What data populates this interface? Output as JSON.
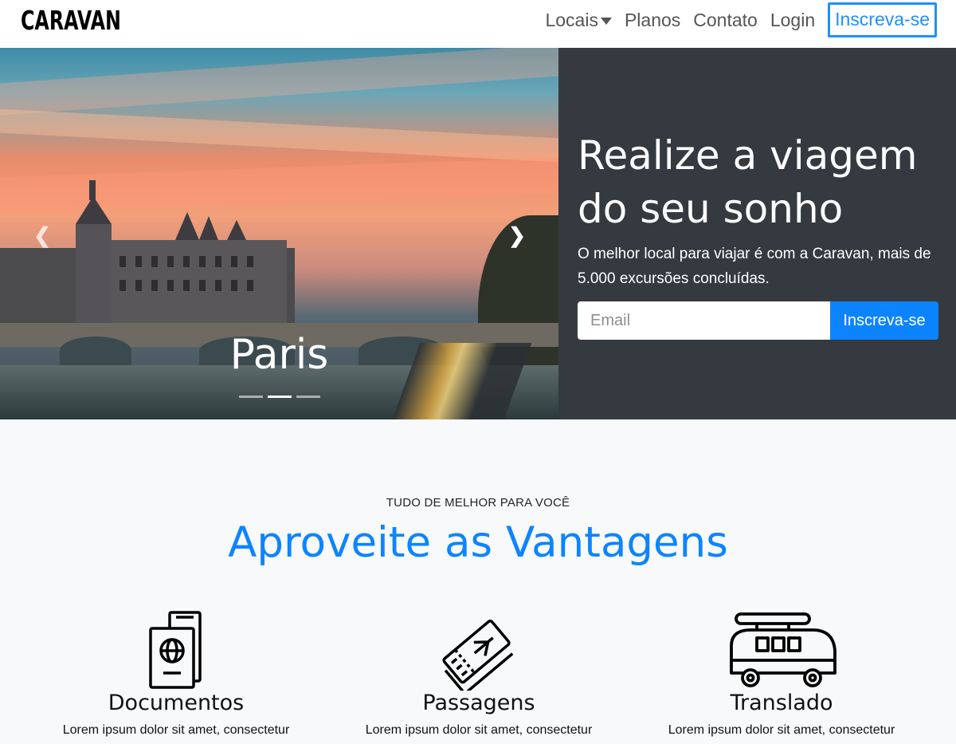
{
  "navbar": {
    "brand": "CARAVAN",
    "links": [
      {
        "label": "Locais"
      },
      {
        "label": "Planos"
      },
      {
        "label": "Contato"
      },
      {
        "label": "Login"
      }
    ],
    "cta": "Inscreva-se"
  },
  "carousel": {
    "caption": "Paris",
    "slide_count": 3,
    "active_slide": 2,
    "prev_icon": "chevron-left-icon",
    "next_icon": "chevron-right-icon"
  },
  "hero": {
    "title": "Realize a viagem do seu sonho",
    "text": "O melhor local para viajar é com a Caravan, mais de 5.000 excursões concluídas.",
    "email_placeholder": "Email",
    "button": "Inscreva-se"
  },
  "features": {
    "eyebrow": "TUDO DE MELHOR PARA VOCÊ",
    "title": "Aproveite as Vantagens",
    "items": [
      {
        "icon": "passport-icon",
        "title": "Documentos",
        "text": "Lorem ipsum dolor sit amet, consectetur"
      },
      {
        "icon": "plane-ticket-icon",
        "title": "Passagens",
        "text": "Lorem ipsum dolor sit amet, consectetur"
      },
      {
        "icon": "van-icon",
        "title": "Translado",
        "text": "Lorem ipsum dolor sit amet, consectetur"
      }
    ]
  },
  "colors": {
    "accent": "#0d84ff",
    "panel": "#343a40",
    "background": "#f8f9fa"
  }
}
